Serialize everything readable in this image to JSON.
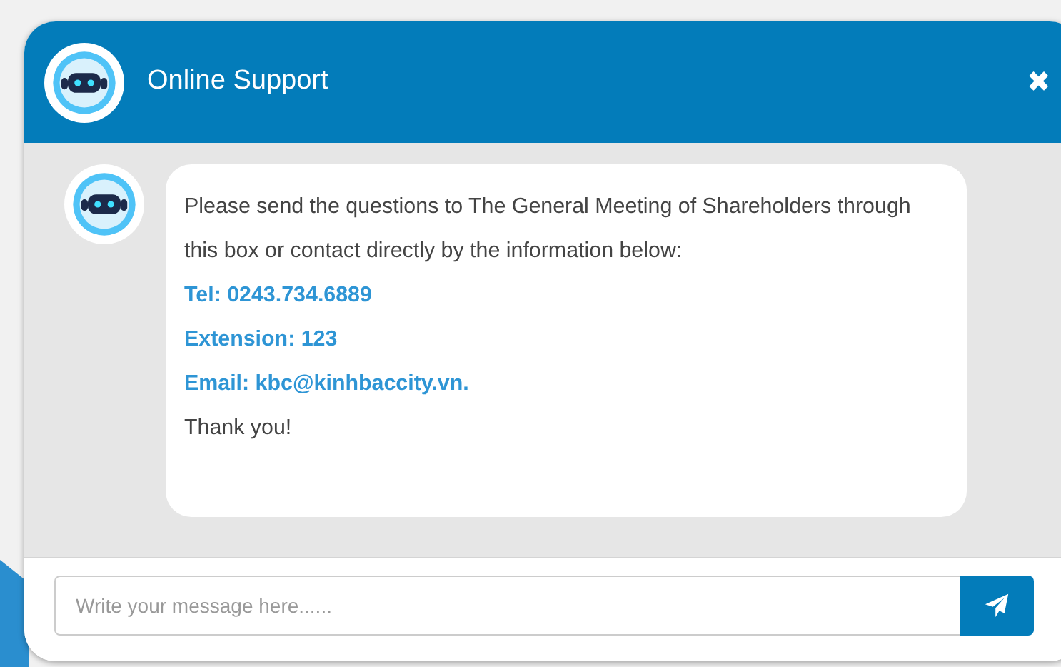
{
  "header": {
    "title": "Online Support",
    "close": "✖"
  },
  "messages": [
    {
      "kind": "text",
      "text": "Please send the questions to The General Meeting of Shareholders through this box or contact directly by the information below:"
    },
    {
      "kind": "contact",
      "text": "Tel: 0243.734.6889"
    },
    {
      "kind": "contact",
      "text": "Extension: 123"
    },
    {
      "kind": "contact",
      "text": "Email: kbc@kinhbaccity.vn."
    },
    {
      "kind": "text",
      "text": "Thank you!"
    }
  ],
  "composer": {
    "placeholder": "Write your message here......"
  }
}
